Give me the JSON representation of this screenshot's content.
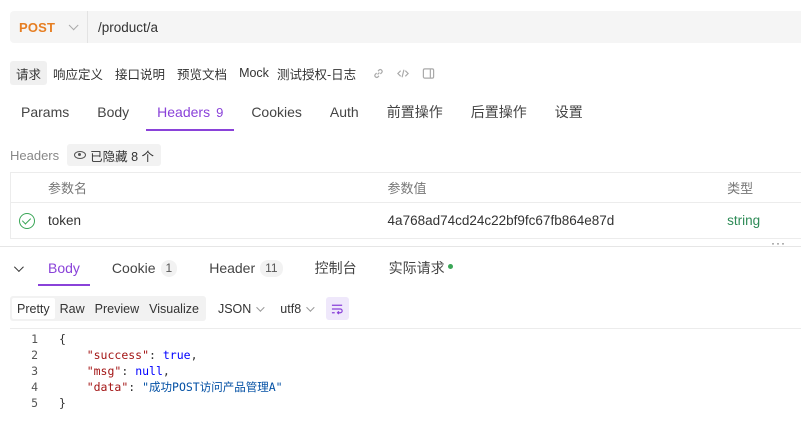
{
  "request": {
    "method": "POST",
    "url": "/product/a"
  },
  "doc_tabs": [
    "请求",
    "响应定义",
    "接口说明",
    "预览文档",
    "Mock"
  ],
  "doc_title": "测试授权-日志",
  "req_tabs": [
    {
      "label": "Params"
    },
    {
      "label": "Body"
    },
    {
      "label": "Headers",
      "count": "9"
    },
    {
      "label": "Cookies"
    },
    {
      "label": "Auth"
    },
    {
      "label": "前置操作"
    },
    {
      "label": "后置操作"
    },
    {
      "label": "设置"
    }
  ],
  "headers_section": {
    "label": "Headers",
    "hidden_label": "已隐藏 8 个"
  },
  "table": {
    "columns": [
      "参数名",
      "参数值",
      "类型"
    ],
    "rows": [
      {
        "name": "token",
        "value": "4a768ad74cd24c22bf9fc67fb864e87d",
        "type": "string"
      }
    ],
    "more": "···"
  },
  "resp_tabs": [
    {
      "label": "Body"
    },
    {
      "label": "Cookie",
      "count": "1"
    },
    {
      "label": "Header",
      "count": "11"
    },
    {
      "label": "控制台"
    },
    {
      "label": "实际请求"
    }
  ],
  "format": {
    "modes": [
      "Pretty",
      "Raw",
      "Preview",
      "Visualize"
    ],
    "language": "JSON",
    "encoding": "utf8"
  },
  "code_lines": [
    {
      "n": "1",
      "text": "{"
    },
    {
      "n": "2",
      "key": "\"success\"",
      "val": "true"
    },
    {
      "n": "3",
      "key": "\"msg\"",
      "val": "null"
    },
    {
      "n": "4",
      "key": "\"data\"",
      "str": "\"成功POST访问产品管理A\""
    },
    {
      "n": "5",
      "text": "}"
    }
  ],
  "colors": {
    "accent": "#8a42d9",
    "method": "#e67e22",
    "success": "#3aa657"
  }
}
